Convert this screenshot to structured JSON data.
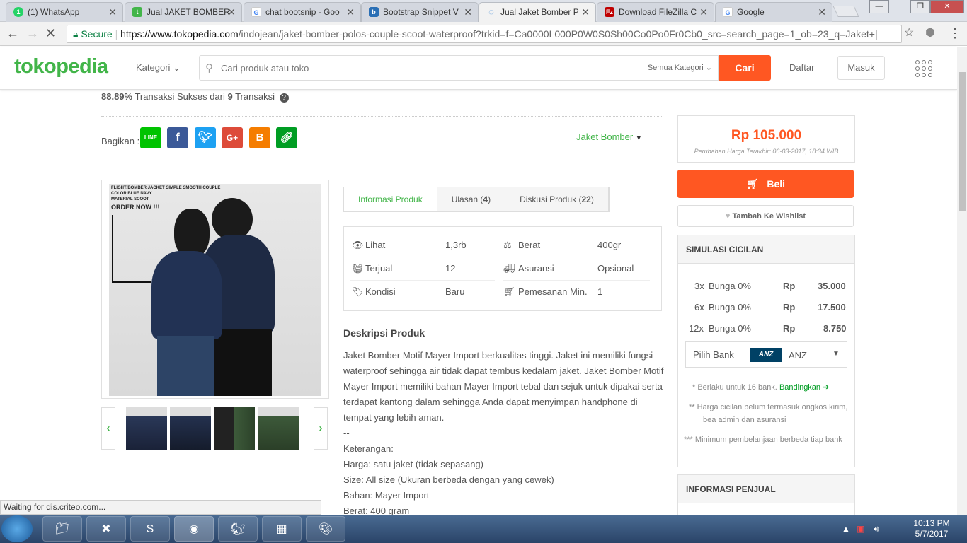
{
  "browser": {
    "tabs": [
      {
        "label": "(1) WhatsApp",
        "icon": "whatsapp-icon",
        "color": "#25d366",
        "glyph": "1"
      },
      {
        "label": "Jual JAKET BOMBER",
        "icon": "tokopedia-icon",
        "color": "#42b549",
        "glyph": "t"
      },
      {
        "label": "chat bootsnip - Goo",
        "icon": "google-icon",
        "color": "#4285f4",
        "glyph": "G"
      },
      {
        "label": "Bootstrap Snippet V",
        "icon": "bootsnipp-icon",
        "color": "#2a6fb5",
        "glyph": "b"
      },
      {
        "label": "Jual Jaket Bomber P",
        "icon": "loading-icon",
        "color": "#4a90d9",
        "glyph": "C"
      },
      {
        "label": "Download FileZilla C",
        "icon": "filezilla-icon",
        "color": "#bf0000",
        "glyph": "Fz"
      },
      {
        "label": "Google",
        "icon": "google-icon",
        "color": "#4285f4",
        "glyph": "G"
      }
    ],
    "secure_label": "Secure",
    "url_host": "https://www.tokopedia.com",
    "url_path": "/indojean/jaket-bomber-polos-couple-scoot-waterproof?trkid=f=Ca0000L000P0W0S0Sh00Co0Po0Fr0Cb0_src=search_page=1_ob=23_q=Jaket+|",
    "status_text": "Waiting for dis.criteo.com..."
  },
  "header": {
    "logo": "tokopedia",
    "kategori": "Kategori",
    "search_placeholder": "Cari produk atau toko",
    "search_category": "Semua Kategori",
    "search_button": "Cari",
    "daftar": "Daftar",
    "masuk": "Masuk"
  },
  "shop": {
    "success_rate": "88.89%",
    "success_text": " Transaksi Sukses dari ",
    "transactions": "9",
    "transactions_text": " Transaksi"
  },
  "share": {
    "label": "Bagikan :",
    "buttons": [
      {
        "name": "line-share-button",
        "glyph": "LINE",
        "color": "#00c300"
      },
      {
        "name": "facebook-share-button",
        "glyph": "f",
        "color": "#3b5998"
      },
      {
        "name": "twitter-share-button",
        "glyph": "t",
        "color": "#1da1f2"
      },
      {
        "name": "googleplus-share-button",
        "glyph": "G+",
        "color": "#dd4b39"
      },
      {
        "name": "blogger-share-button",
        "glyph": "B",
        "color": "#f57d00"
      },
      {
        "name": "link-share-button",
        "glyph": "⛓",
        "color": "#009d23"
      }
    ],
    "category_tag": "Jaket Bomber"
  },
  "product_image": {
    "caption_lines": [
      "FLIGHT/BOMBER JACKET SIMPLE SMOOTH COUPLE",
      "COLOR BLUE NAVY",
      "MATERIAL SCOOT"
    ],
    "order_text": "ORDER NOW !!!"
  },
  "tabs": [
    {
      "label": "Informasi Produk",
      "count": ""
    },
    {
      "label": "Ulasan",
      "count": "4"
    },
    {
      "label": "Diskusi Produk",
      "count": "22"
    }
  ],
  "info": {
    "lihat_label": "Lihat",
    "lihat_value": "1,3rb",
    "berat_label": "Berat",
    "berat_value": "400gr",
    "terjual_label": "Terjual",
    "terjual_value": "12",
    "asuransi_label": "Asuransi",
    "asuransi_value": "Opsional",
    "kondisi_label": "Kondisi",
    "kondisi_value": "Baru",
    "pemesanan_label": "Pemesanan Min.",
    "pemesanan_value": "1"
  },
  "description": {
    "title": "Deskripsi Produk",
    "lines": [
      "Jaket Bomber Motif Mayer Import berkualitas tinggi. Jaket ini memiliki fungsi waterproof sehingga air tidak dapat tembus kedalam jaket. Jaket Bomber Motif Mayer Import memiliki bahan Mayer Import tebal dan sejuk untuk dipakai serta terdapat kantong dalam sehingga Anda dapat menyimpan handphone di tempat yang lebih aman.",
      "--",
      "Keterangan:",
      "Harga: satu jaket (tidak sepasang)",
      "Size: All size (Ukuran berbeda dengan yang cewek)",
      "Bahan: Mayer Import",
      "Berat: 400 gram"
    ]
  },
  "purchase": {
    "price": "Rp 105.000",
    "price_updated": "Perubahan Harga Terakhir: 06-03-2017, 18:34 WIB",
    "buy_label": "Beli",
    "wishlist_label": "Tambah Ke Wishlist"
  },
  "installment": {
    "title": "SIMULASI CICILAN",
    "rows": [
      {
        "term": "3x",
        "label": "Bunga 0%",
        "currency": "Rp",
        "amount": "35.000"
      },
      {
        "term": "6x",
        "label": "Bunga 0%",
        "currency": "Rp",
        "amount": "17.500"
      },
      {
        "term": "12x",
        "label": "Bunga 0%",
        "currency": "Rp",
        "amount": "8.750"
      }
    ],
    "bank_label": "Pilih Bank",
    "bank_logo": "ANZ",
    "bank_value": "ANZ",
    "note1": "Berlaku untuk 16 bank.",
    "note1_link": "Bandingkan",
    "note2": "Harga cicilan belum termasuk ongkos kirim, bea admin dan asuransi",
    "note3": "Minimum pembelanjaan berbeda tiap bank"
  },
  "seller": {
    "title": "INFORMASI PENJUAL"
  },
  "taskbar": {
    "time": "10:13 PM",
    "date": "5/7/2017"
  }
}
